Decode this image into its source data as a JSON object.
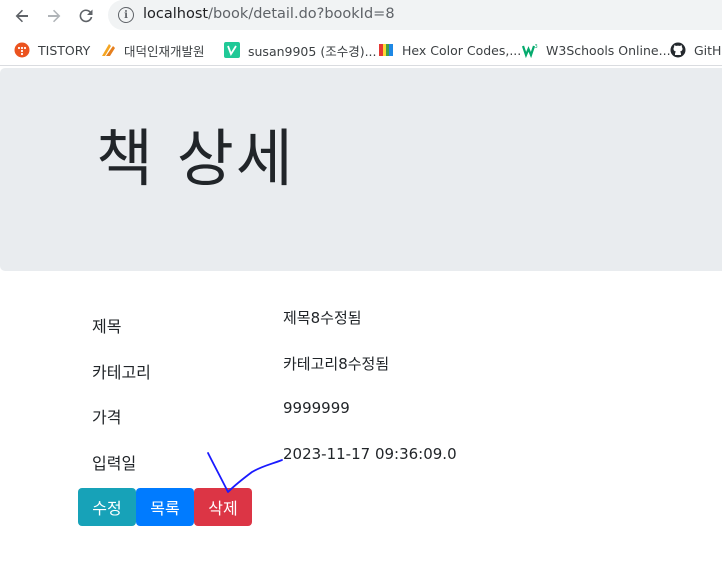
{
  "browser": {
    "url_host": "localhost",
    "url_path": "/book/detail.do?bookId=8"
  },
  "bookmarks": [
    {
      "label": "TISTORY",
      "icon": "tistory-icon"
    },
    {
      "label": "대덕인재개발원",
      "icon": "ddit-icon"
    },
    {
      "label": "susan9905 (조수경)...",
      "icon": "velog-icon"
    },
    {
      "label": "Hex Color Codes,...",
      "icon": "book-icon"
    },
    {
      "label": "W3Schools Online...",
      "icon": "w3schools-icon"
    },
    {
      "label": "GitHu",
      "icon": "github-icon"
    }
  ],
  "page": {
    "title": "책 상세"
  },
  "detail": {
    "rows": [
      {
        "label": "제목",
        "value": "제목8수정됨"
      },
      {
        "label": "카테고리",
        "value": "카테고리8수정됨"
      },
      {
        "label": "가격",
        "value": "9999999"
      },
      {
        "label": "입력일",
        "value": "2023-11-17 09:36:09.0"
      }
    ]
  },
  "actions": {
    "edit_label": "수정",
    "list_label": "목록",
    "delete_label": "삭제"
  },
  "colors": {
    "edit": "#17a2b8",
    "list": "#007bff",
    "delete": "#dc3545",
    "jumbotron": "#e9ecef",
    "annotation": "#1a1aff"
  }
}
